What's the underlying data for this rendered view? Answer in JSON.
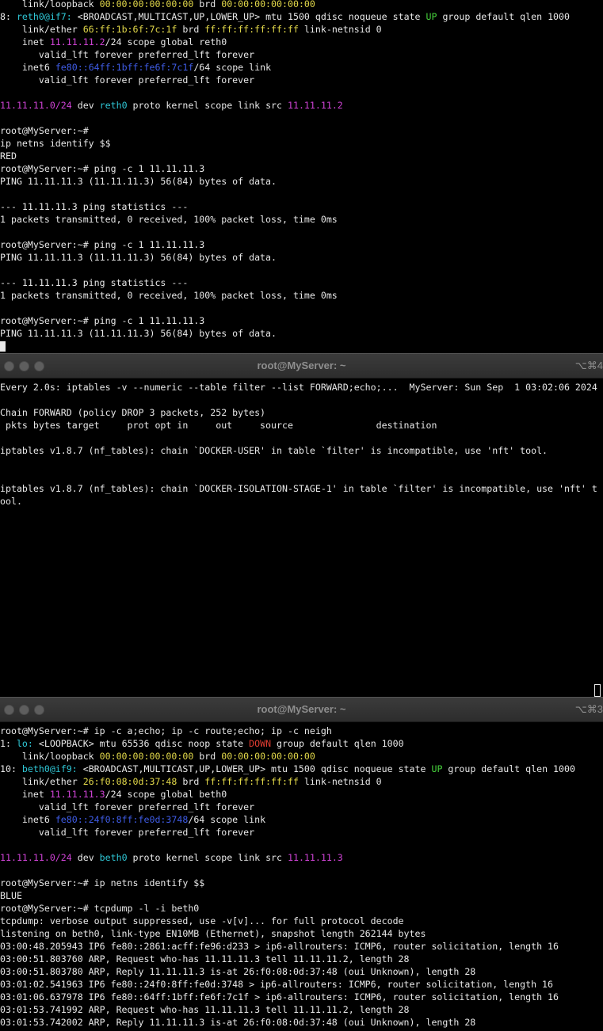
{
  "colors": {
    "green": "#46d23c",
    "yellow": "#e3d94a",
    "magenta": "#d043d6",
    "cyan": "#2fc7d6",
    "red": "#e03c31",
    "blue": "#3f5ce6",
    "text": "#e8e8e8"
  },
  "pane1": {
    "lines": [
      [
        {
          "t": "    link/loopback "
        },
        {
          "t": "00:00:00:00:00:00",
          "c": "yellow"
        },
        {
          "t": " brd "
        },
        {
          "t": "00:00:00:00:00:00",
          "c": "yellow"
        }
      ],
      [
        {
          "t": "8: "
        },
        {
          "t": "reth0@if7:",
          "c": "cyan"
        },
        {
          "t": " <BROADCAST,MULTICAST,UP,LOWER_UP> mtu 1500 qdisc noqueue state "
        },
        {
          "t": "UP",
          "c": "green"
        },
        {
          "t": " group default qlen 1000"
        }
      ],
      [
        {
          "t": "    link/ether "
        },
        {
          "t": "66:ff:1b:6f:7c:1f",
          "c": "yellow"
        },
        {
          "t": " brd "
        },
        {
          "t": "ff:ff:ff:ff:ff:ff",
          "c": "yellow"
        },
        {
          "t": " link-netnsid 0"
        }
      ],
      [
        {
          "t": "    inet "
        },
        {
          "t": "11.11.11.2",
          "c": "magenta"
        },
        {
          "t": "/24 scope global reth0"
        }
      ],
      [
        {
          "t": "       valid_lft forever preferred_lft forever"
        }
      ],
      [
        {
          "t": "    inet6 "
        },
        {
          "t": "fe80::64ff:1bff:fe6f:7c1f",
          "c": "blue"
        },
        {
          "t": "/64 scope link"
        }
      ],
      [
        {
          "t": "       valid_lft forever preferred_lft forever"
        }
      ],
      [
        {
          "t": ""
        }
      ],
      [
        {
          "t": "11.11.11.0/24",
          "c": "magenta"
        },
        {
          "t": " dev "
        },
        {
          "t": "reth0",
          "c": "cyan"
        },
        {
          "t": " proto kernel scope link src "
        },
        {
          "t": "11.11.11.2",
          "c": "magenta"
        }
      ],
      [
        {
          "t": ""
        }
      ],
      [
        {
          "t": "root@MyServer:~#"
        }
      ],
      [
        {
          "t": "ip netns identify $$"
        }
      ],
      [
        {
          "t": "RED"
        }
      ],
      [
        {
          "t": "root@MyServer:~# ping -c 1 11.11.11.3"
        }
      ],
      [
        {
          "t": "PING 11.11.11.3 (11.11.11.3) 56(84) bytes of data."
        }
      ],
      [
        {
          "t": ""
        }
      ],
      [
        {
          "t": "--- 11.11.11.3 ping statistics ---"
        }
      ],
      [
        {
          "t": "1 packets transmitted, 0 received, 100% packet loss, time 0ms"
        }
      ],
      [
        {
          "t": ""
        }
      ],
      [
        {
          "t": "root@MyServer:~# ping -c 1 11.11.11.3"
        }
      ],
      [
        {
          "t": "PING 11.11.11.3 (11.11.11.3) 56(84) bytes of data."
        }
      ],
      [
        {
          "t": ""
        }
      ],
      [
        {
          "t": "--- 11.11.11.3 ping statistics ---"
        }
      ],
      [
        {
          "t": "1 packets transmitted, 0 received, 100% packet loss, time 0ms"
        }
      ],
      [
        {
          "t": ""
        }
      ],
      [
        {
          "t": "root@MyServer:~# ping -c 1 11.11.11.3"
        }
      ],
      [
        {
          "t": "PING 11.11.11.3 (11.11.11.3) 56(84) bytes of data."
        }
      ],
      [
        {
          "cursor": true
        }
      ]
    ]
  },
  "pane2": {
    "title": "root@MyServer: ~",
    "shortcut": "⌥⌘4",
    "lines": [
      [
        {
          "t": "Every 2.0s: iptables -v --numeric --table filter --list FORWARD;echo;...  MyServer: Sun Sep  1 03:02:06 2024"
        }
      ],
      [
        {
          "t": ""
        }
      ],
      [
        {
          "t": "Chain FORWARD (policy DROP 3 packets, 252 bytes)"
        }
      ],
      [
        {
          "t": " pkts bytes target     prot opt in     out     source               destination"
        }
      ],
      [
        {
          "t": ""
        }
      ],
      [
        {
          "t": "iptables v1.8.7 (nf_tables): chain `DOCKER-USER' in table `filter' is incompatible, use 'nft' tool."
        }
      ],
      [
        {
          "t": ""
        }
      ],
      [
        {
          "t": ""
        }
      ],
      [
        {
          "t": "iptables v1.8.7 (nf_tables): chain `DOCKER-ISOLATION-STAGE-1' in table `filter' is incompatible, use 'nft' t"
        }
      ],
      [
        {
          "t": "ool."
        }
      ]
    ]
  },
  "pane3": {
    "title": "root@MyServer: ~",
    "shortcut": "⌥⌘3",
    "lines": [
      [
        {
          "t": "root@MyServer:~# ip -c a;echo; ip -c route;echo; ip -c neigh"
        }
      ],
      [
        {
          "t": "1: "
        },
        {
          "t": "lo:",
          "c": "cyan"
        },
        {
          "t": " <LOOPBACK> mtu 65536 qdisc noop state "
        },
        {
          "t": "DOWN",
          "c": "red"
        },
        {
          "t": " group default qlen 1000"
        }
      ],
      [
        {
          "t": "    link/loopback "
        },
        {
          "t": "00:00:00:00:00:00",
          "c": "yellow"
        },
        {
          "t": " brd "
        },
        {
          "t": "00:00:00:00:00:00",
          "c": "yellow"
        }
      ],
      [
        {
          "t": "10: "
        },
        {
          "t": "beth0@if9:",
          "c": "cyan"
        },
        {
          "t": " <BROADCAST,MULTICAST,UP,LOWER_UP> mtu 1500 qdisc noqueue state "
        },
        {
          "t": "UP",
          "c": "green"
        },
        {
          "t": " group default qlen 1000"
        }
      ],
      [
        {
          "t": "    link/ether "
        },
        {
          "t": "26:f0:08:0d:37:48",
          "c": "yellow"
        },
        {
          "t": " brd "
        },
        {
          "t": "ff:ff:ff:ff:ff:ff",
          "c": "yellow"
        },
        {
          "t": " link-netnsid 0"
        }
      ],
      [
        {
          "t": "    inet "
        },
        {
          "t": "11.11.11.3",
          "c": "magenta"
        },
        {
          "t": "/24 scope global beth0"
        }
      ],
      [
        {
          "t": "       valid_lft forever preferred_lft forever"
        }
      ],
      [
        {
          "t": "    inet6 "
        },
        {
          "t": "fe80::24f0:8ff:fe0d:3748",
          "c": "blue"
        },
        {
          "t": "/64 scope link"
        }
      ],
      [
        {
          "t": "       valid_lft forever preferred_lft forever"
        }
      ],
      [
        {
          "t": ""
        }
      ],
      [
        {
          "t": "11.11.11.0/24",
          "c": "magenta"
        },
        {
          "t": " dev "
        },
        {
          "t": "beth0",
          "c": "cyan"
        },
        {
          "t": " proto kernel scope link src "
        },
        {
          "t": "11.11.11.3",
          "c": "magenta"
        }
      ],
      [
        {
          "t": ""
        }
      ],
      [
        {
          "t": "root@MyServer:~# ip netns identify $$"
        }
      ],
      [
        {
          "t": "BLUE"
        }
      ],
      [
        {
          "t": "root@MyServer:~# tcpdump -l -i beth0"
        }
      ],
      [
        {
          "t": "tcpdump: verbose output suppressed, use -v[v]... for full protocol decode"
        }
      ],
      [
        {
          "t": "listening on beth0, link-type EN10MB (Ethernet), snapshot length 262144 bytes"
        }
      ],
      [
        {
          "t": "03:00:48.205943 IP6 fe80::2861:acff:fe96:d233 > ip6-allrouters: ICMP6, router solicitation, length 16"
        }
      ],
      [
        {
          "t": "03:00:51.803760 ARP, Request who-has 11.11.11.3 tell 11.11.11.2, length 28"
        }
      ],
      [
        {
          "t": "03:00:51.803780 ARP, Reply 11.11.11.3 is-at 26:f0:08:0d:37:48 (oui Unknown), length 28"
        }
      ],
      [
        {
          "t": "03:01:02.541963 IP6 fe80::24f0:8ff:fe0d:3748 > ip6-allrouters: ICMP6, router solicitation, length 16"
        }
      ],
      [
        {
          "t": "03:01:06.637978 IP6 fe80::64ff:1bff:fe6f:7c1f > ip6-allrouters: ICMP6, router solicitation, length 16"
        }
      ],
      [
        {
          "t": "03:01:53.741992 ARP, Request who-has 11.11.11.3 tell 11.11.11.2, length 28"
        }
      ],
      [
        {
          "t": "03:01:53.742002 ARP, Reply 11.11.11.3 is-at 26:f0:08:0d:37:48 (oui Unknown), length 28"
        }
      ]
    ]
  }
}
